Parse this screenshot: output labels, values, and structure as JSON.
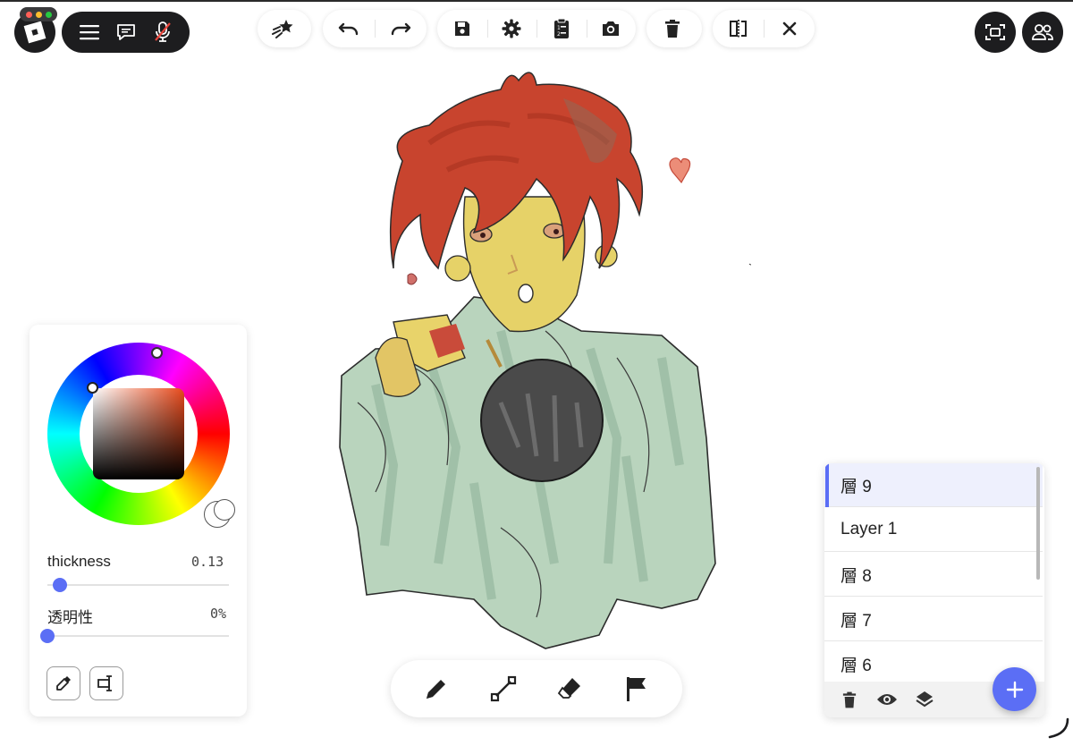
{
  "roblox": {
    "icons": [
      "roblox-logo",
      "hamburger-menu-icon",
      "chat-icon",
      "mic-muted-icon"
    ],
    "traffic_colors": [
      "#ff5f57",
      "#febc2e",
      "#28c840"
    ]
  },
  "toolbar": {
    "groups": [
      [
        "magic-star-icon"
      ],
      [
        "undo-icon",
        "redo-icon"
      ],
      [
        "save-icon",
        "settings-gear-icon",
        "clipboard-list-icon",
        "camera-icon"
      ],
      [
        "trash-icon"
      ],
      [
        "mirror-flip-icon",
        "close-icon"
      ]
    ]
  },
  "top_right": [
    "screenshot-frame-icon",
    "friends-icon"
  ],
  "color_panel": {
    "hue_color": "#e84a1c",
    "thickness_label": "thickness",
    "thickness_value": "0.13",
    "opacity_label": "透明性",
    "opacity_value": "0%",
    "accent": "#5b6ef5",
    "thickness_level": 0.03,
    "opacity_level": 0.0
  },
  "bottom_tools": [
    "pencil-icon",
    "line-tool-icon",
    "eraser-icon",
    "flag-icon"
  ],
  "layers": {
    "items": [
      "層 9",
      "Layer 1",
      "層 8",
      "層 7",
      "層 6"
    ],
    "active_index": 0,
    "footer_icons": [
      "trash-icon",
      "eye-icon",
      "layers-stack-icon"
    ],
    "add_icon": "plus-icon"
  }
}
